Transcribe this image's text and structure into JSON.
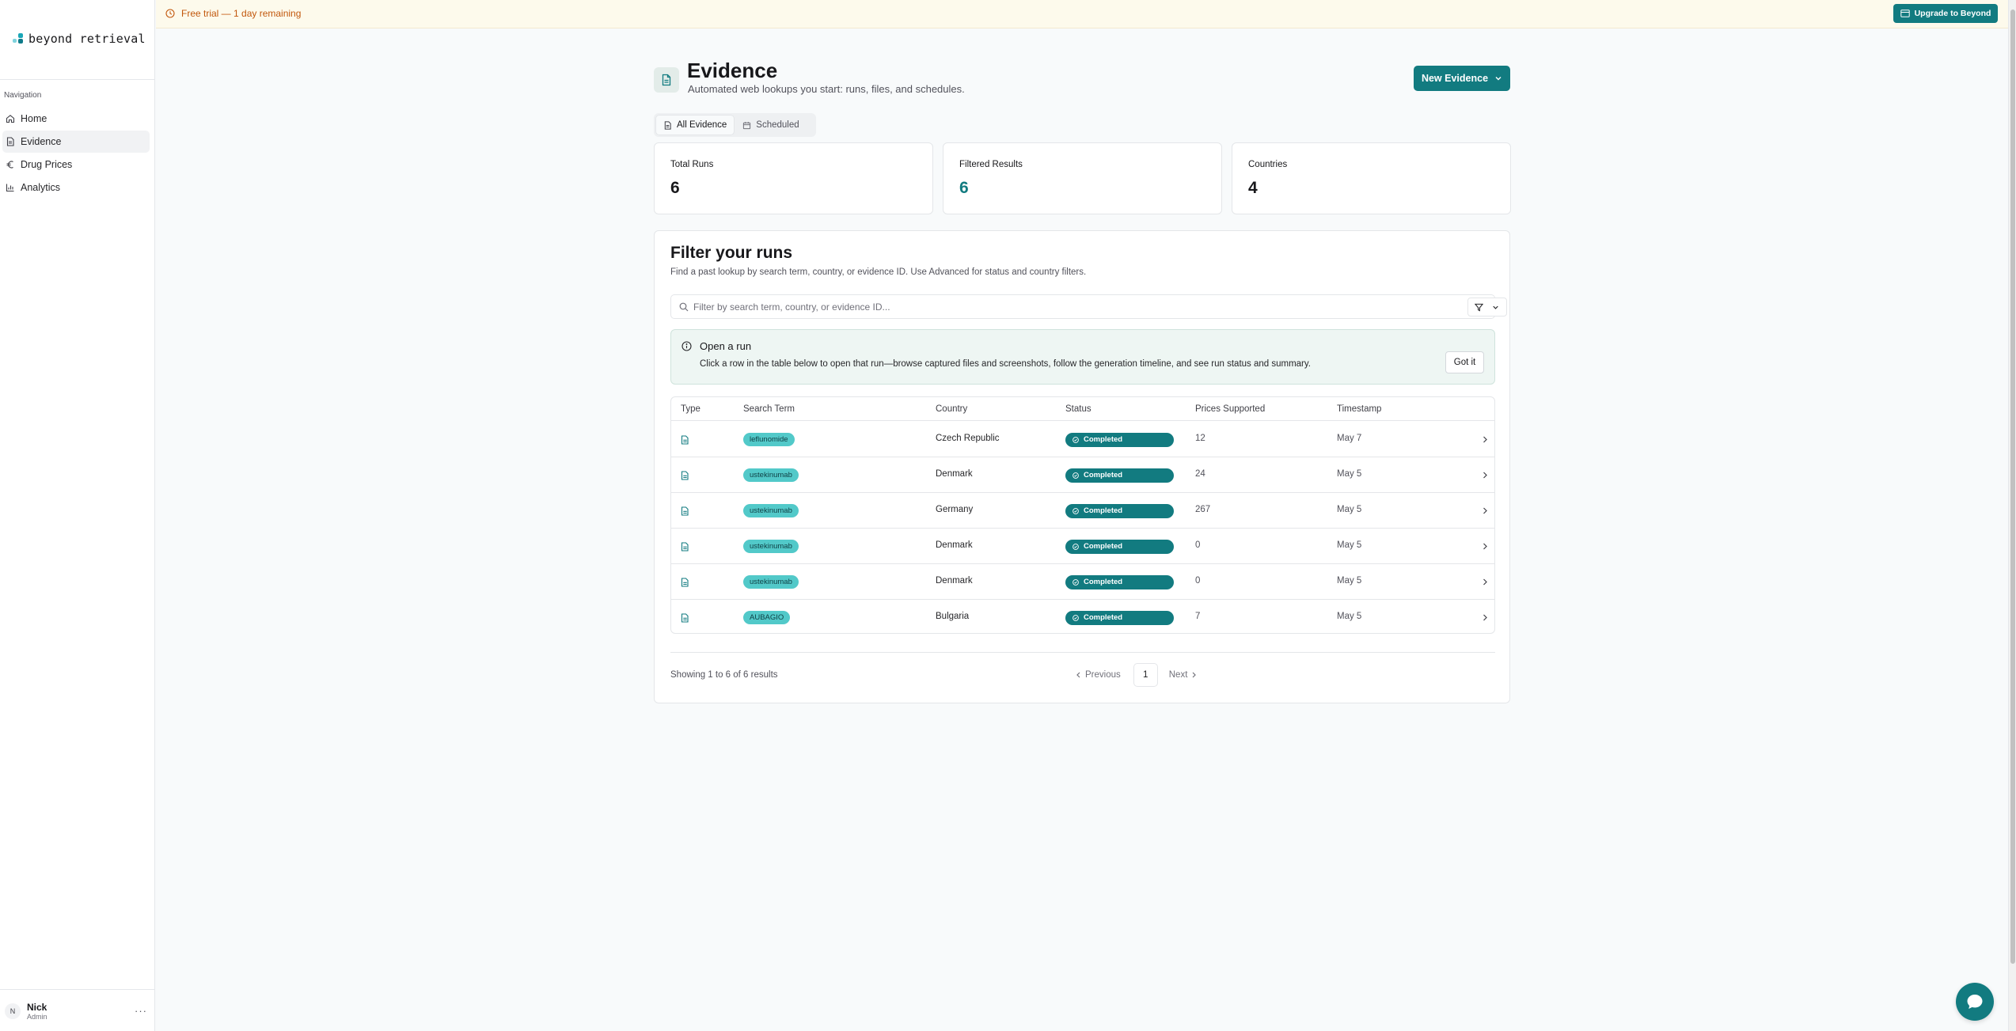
{
  "brand": {
    "name": "beyond retrieval"
  },
  "sidebar": {
    "heading": "Navigation",
    "items": [
      {
        "label": "Home",
        "icon": "home-icon"
      },
      {
        "label": "Evidence",
        "icon": "document-icon",
        "active": true
      },
      {
        "label": "Drug Prices",
        "icon": "euro-icon"
      },
      {
        "label": "Analytics",
        "icon": "bar-chart-icon"
      }
    ],
    "user": {
      "initial": "N",
      "name": "Nick",
      "role": "Admin",
      "menu": "···"
    }
  },
  "banner": {
    "text": "Free trial — 1 day remaining",
    "upgrade_label": "Upgrade to Beyond"
  },
  "header": {
    "title": "Evidence",
    "subtitle": "Automated web lookups you start: runs, files, and schedules.",
    "new_button": "New Evidence"
  },
  "tabs": [
    {
      "label": "All Evidence",
      "active": true
    },
    {
      "label": "Scheduled",
      "active": false
    }
  ],
  "stats": [
    {
      "label": "Total Runs",
      "value": "6"
    },
    {
      "label": "Filtered Results",
      "value": "6"
    },
    {
      "label": "Countries",
      "value": "4"
    }
  ],
  "filter": {
    "title": "Filter your runs",
    "subtitle": "Find a past lookup by search term, country, or evidence ID. Use Advanced for status and country filters.",
    "search_placeholder": "Filter by search term, country, or evidence ID...",
    "search_value": ""
  },
  "callout": {
    "title": "Open a run",
    "body": "Click a row in the table below to open that run—browse captured files and screenshots, follow the generation timeline, and see run status and summary.",
    "button": "Got it"
  },
  "table": {
    "headers": [
      "Type",
      "Search Term",
      "Country",
      "Status",
      "Prices Supported",
      "Timestamp"
    ],
    "rows": [
      {
        "term": "leflunomide",
        "country": "Czech Republic",
        "status": "Completed",
        "prices": "12",
        "timestamp": "May 7"
      },
      {
        "term": "ustekinumab",
        "country": "Denmark",
        "status": "Completed",
        "prices": "24",
        "timestamp": "May 5"
      },
      {
        "term": "ustekinumab",
        "country": "Germany",
        "status": "Completed",
        "prices": "267",
        "timestamp": "May 5"
      },
      {
        "term": "ustekinumab",
        "country": "Denmark",
        "status": "Completed",
        "prices": "0",
        "timestamp": "May 5"
      },
      {
        "term": "ustekinumab",
        "country": "Denmark",
        "status": "Completed",
        "prices": "0",
        "timestamp": "May 5"
      },
      {
        "term": "AUBAGIO",
        "country": "Bulgaria",
        "status": "Completed",
        "prices": "7",
        "timestamp": "May 5"
      }
    ]
  },
  "pagination": {
    "showing": "Showing 1 to 6 of 6 results",
    "previous": "Previous",
    "page": "1",
    "next": "Next"
  },
  "colors": {
    "accent": "#127b80",
    "badge": "#52c9c9",
    "banner_text": "#c2570c"
  }
}
